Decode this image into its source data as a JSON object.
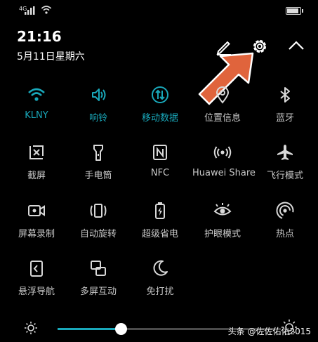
{
  "status_bar": {
    "network_type": "4G",
    "battery_level": 0.9
  },
  "header": {
    "time": "21:16",
    "date": "5月11日星期六"
  },
  "header_icons": [
    "edit-icon",
    "settings-icon",
    "collapse-icon"
  ],
  "tiles": [
    {
      "label": "KLNY",
      "icon": "wifi-icon",
      "active": true
    },
    {
      "label": "响铃",
      "icon": "ring-icon",
      "active": true
    },
    {
      "label": "移动数据",
      "icon": "mobile-data-icon",
      "active": true
    },
    {
      "label": "位置信息",
      "icon": "location-icon",
      "active": false
    },
    {
      "label": "蓝牙",
      "icon": "bluetooth-icon",
      "active": false
    },
    {
      "label": "截屏",
      "icon": "screenshot-icon",
      "active": false
    },
    {
      "label": "手电筒",
      "icon": "flashlight-icon",
      "active": false
    },
    {
      "label": "NFC",
      "icon": "nfc-icon",
      "active": false
    },
    {
      "label": "Huawei Share",
      "icon": "huawei-share-icon",
      "active": false
    },
    {
      "label": "飞行模式",
      "icon": "airplane-icon",
      "active": false
    },
    {
      "label": "屏幕录制",
      "icon": "screen-record-icon",
      "active": false
    },
    {
      "label": "自动旋转",
      "icon": "auto-rotate-icon",
      "active": false
    },
    {
      "label": "超级省电",
      "icon": "power-saver-icon",
      "active": false
    },
    {
      "label": "护眼模式",
      "icon": "eye-comfort-icon",
      "active": false
    },
    {
      "label": "热点",
      "icon": "hotspot-icon",
      "active": false
    },
    {
      "label": "悬浮导航",
      "icon": "floating-nav-icon",
      "active": false
    },
    {
      "label": "多屏互动",
      "icon": "multi-screen-icon",
      "active": false
    },
    {
      "label": "免打扰",
      "icon": "do-not-disturb-icon",
      "active": false
    }
  ],
  "brightness": {
    "level": 0.29
  },
  "watermark": "头条 @佐佐佑佑2015",
  "colors": {
    "accent": "#19a8ba",
    "background": "#000000",
    "arrow": "#e0643c"
  }
}
